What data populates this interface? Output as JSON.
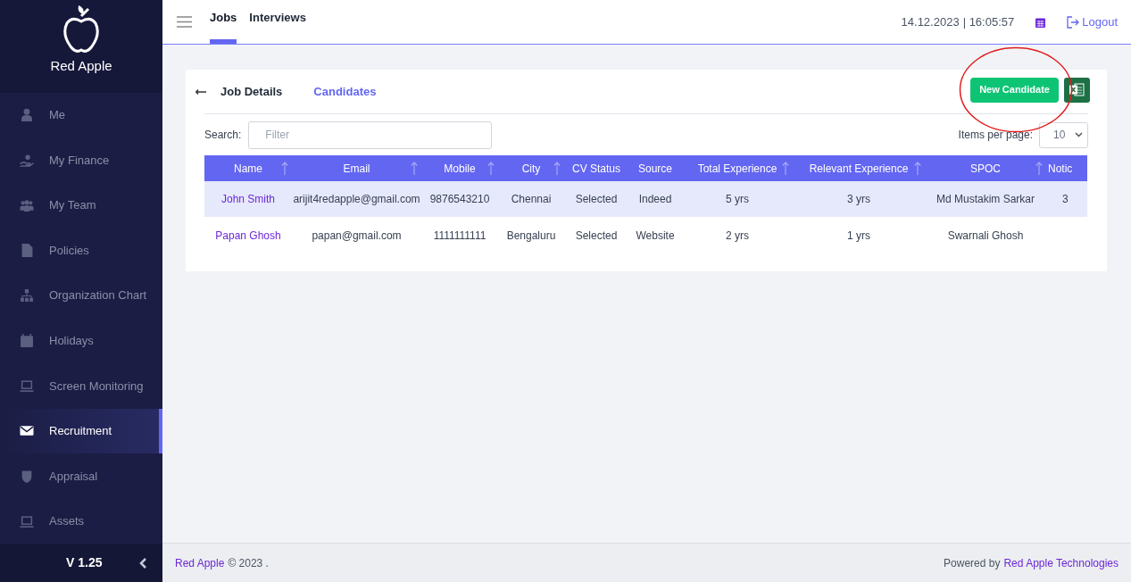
{
  "sidebar": {
    "brand": "Red Apple",
    "items": [
      {
        "label": "Me",
        "selected": false
      },
      {
        "label": "My Finance",
        "selected": false
      },
      {
        "label": "My Team",
        "selected": false
      },
      {
        "label": "Policies",
        "selected": false
      },
      {
        "label": "Organization Chart",
        "selected": false
      },
      {
        "label": "Holidays",
        "selected": false
      },
      {
        "label": "Screen Monitoring",
        "selected": false
      },
      {
        "label": "Recruitment",
        "selected": true
      },
      {
        "label": "Appraisal",
        "selected": false
      },
      {
        "label": "Assets",
        "selected": false
      }
    ],
    "version": "V 1.25"
  },
  "topbar": {
    "tabs": [
      {
        "label": "Jobs",
        "selected": true
      },
      {
        "label": "Interviews",
        "selected": false
      }
    ],
    "date": "14.12.2023",
    "time": "| 16:05:57",
    "logout": "Logout"
  },
  "card": {
    "tabs": [
      {
        "label": "Job Details",
        "selected": false
      },
      {
        "label": "Candidates",
        "selected": true
      }
    ],
    "new_candidate_button": {
      "label": "New Candidate",
      "circled": true
    },
    "search": {
      "label": "Search:",
      "placeholder": "Filter"
    },
    "items_per_page": {
      "label": "Items per page:",
      "value": "10"
    },
    "table": {
      "columns": [
        {
          "label": "Name",
          "sortable": true
        },
        {
          "label": "Email",
          "sortable": true
        },
        {
          "label": "Mobile",
          "sortable": true
        },
        {
          "label": "City",
          "sortable": true
        },
        {
          "label": "CV Status",
          "sortable": false
        },
        {
          "label": "Source",
          "sortable": false
        },
        {
          "label": "Total Experience",
          "sortable": true
        },
        {
          "label": "Relevant Experience",
          "sortable": true
        },
        {
          "label": "SPOC",
          "sortable": true
        },
        {
          "label": "Notic",
          "sortable": false
        }
      ],
      "rows": [
        {
          "highlighted": true,
          "cells": [
            "John Smith",
            "arijit4redapple@gmail.com",
            "9876543210",
            "Chennai",
            "Selected",
            "Indeed",
            "5 yrs",
            "3 yrs",
            "Md Mustakim Sarkar",
            "3"
          ]
        },
        {
          "highlighted": false,
          "cells": [
            "Papan Ghosh",
            "papan@gmail.com",
            "1111111111",
            "Bengaluru",
            "Selected",
            "Website",
            "2 yrs",
            "1 yrs",
            "Swarnali Ghosh",
            ""
          ]
        }
      ]
    }
  },
  "footer": {
    "brand": "Red Apple",
    "copyright": "© 2023 .",
    "powered_by": "Powered by",
    "company": "Red Apple Technologies"
  }
}
